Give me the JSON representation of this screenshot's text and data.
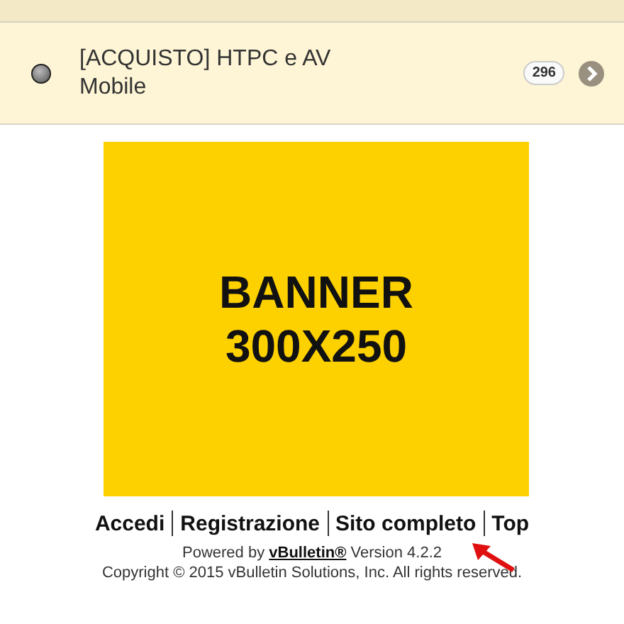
{
  "forum_row": {
    "title": "[ACQUISTO] HTPC e AV Mobile",
    "count": "296",
    "has_new": false
  },
  "banner": {
    "text": "BANNER 300X250"
  },
  "footer_links": [
    "Accedi",
    "Registrazione",
    "Sito completo",
    "Top"
  ],
  "powered": {
    "prefix": "Powered by",
    "link": "vBulletin®",
    "suffix": "Version 4.2.2"
  },
  "copyright": "Copyright © 2015 vBulletin Solutions, Inc. All rights reserved."
}
